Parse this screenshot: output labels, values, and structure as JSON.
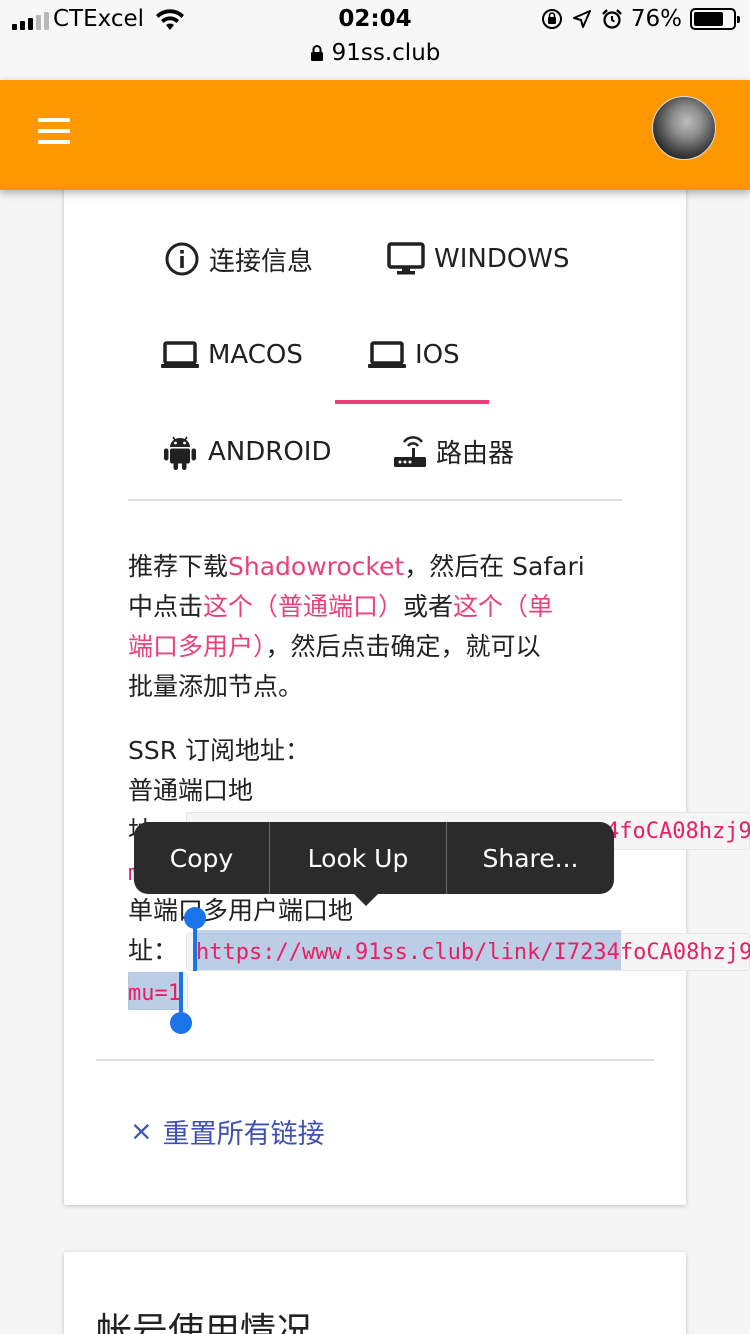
{
  "status_bar": {
    "carrier": "CTExcel",
    "time": "02:04",
    "battery": "76%",
    "battery_level": 0.76,
    "url": "91ss.club"
  },
  "tabs": [
    {
      "label": "连接信息",
      "icon": "info-icon"
    },
    {
      "label": "WINDOWS",
      "icon": "desktop-icon"
    },
    {
      "label": "MACOS",
      "icon": "laptop-icon"
    },
    {
      "label": "IOS",
      "icon": "laptop-icon",
      "active": true
    },
    {
      "label": "ANDROID",
      "icon": "android-icon"
    },
    {
      "label": "路由器",
      "icon": "router-icon"
    }
  ],
  "description": {
    "t1": "推荐下载",
    "link_app": "Shadowrocket",
    "t2": "，然后在 Safari",
    "t3": "中点击",
    "link_normal": "这个（普通端口）",
    "t4": "或者",
    "link_multi_a": "这个（单",
    "link_multi_b": "端口多用户）",
    "t5": "，然后点击确定，就可以",
    "t6": "批量添加节点。"
  },
  "subscription": {
    "title": "SSR 订阅地址：",
    "normal_label_a": "普通端口地",
    "normal_label_b": "址：",
    "normal_url_visible": "4foCA08hzj9",
    "normal_url_wrap": "m",
    "multi_label_a": "单端口多用户端口地",
    "multi_label_b": "址：",
    "multi_url_line1": "https://www.91ss.club/link/I7234foCA08hzj9",
    "multi_url_line2": "mu=1"
  },
  "context_menu": {
    "copy": "Copy",
    "look_up": "Look Up",
    "share": "Share..."
  },
  "reset_link": {
    "icon": "×",
    "label": "重置所有链接"
  },
  "next_card": {
    "title": "帐号使用情况"
  },
  "colors": {
    "app_bar": "#ff9800",
    "accent_pink": "#ec407a",
    "link_blue": "#3f51b5",
    "selection_blue": "#1a73e8"
  }
}
